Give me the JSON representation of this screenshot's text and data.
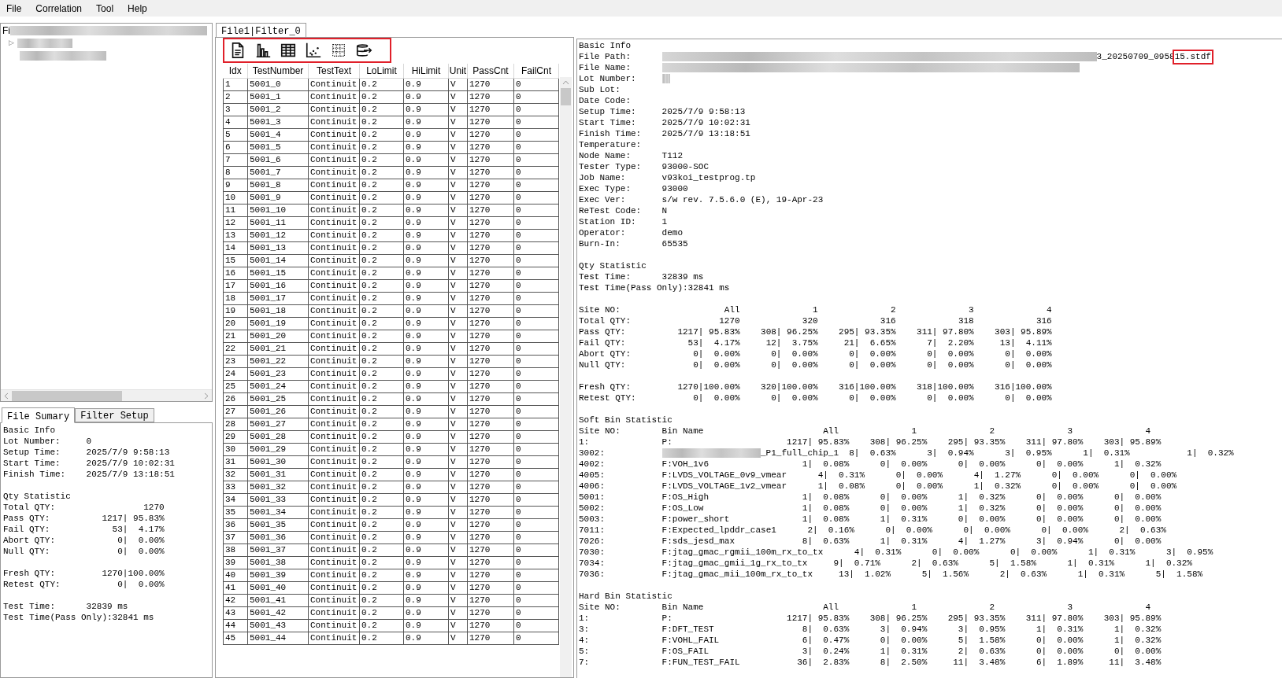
{
  "menu": [
    "File",
    "Correlation",
    "Tool",
    "Help"
  ],
  "file_tree": {
    "title": "Fi",
    "expander": "▷"
  },
  "left_tabs": [
    {
      "label": "File Sumary",
      "selected": true
    },
    {
      "label": "Filter Setup",
      "selected": false
    }
  ],
  "file_summary": {
    "basic_title": "Basic Info",
    "basic": [
      {
        "label": "Lot Number:",
        "value": "0"
      },
      {
        "label": "Setup Time:",
        "value": "2025/7/9 9:58:13"
      },
      {
        "label": "Start Time:",
        "value": "2025/7/9 10:02:31"
      },
      {
        "label": "Finish Time:",
        "value": "2025/7/9 13:18:51"
      }
    ],
    "qty_title": "Qty Statistic",
    "qty_lines": [
      "Total QTY:                 1270",
      "Pass QTY:          1217| 95.83%",
      "Fail QTY:            53|  4.17%",
      "Abort QTY:            0|  0.00%",
      "Null QTY:             0|  0.00%"
    ],
    "fresh_lines": [
      "Fresh QTY:         1270|100.00%",
      "Retest QTY:           0|  0.00%"
    ],
    "time": [
      {
        "label": "Test Time:",
        "value": "32839 ms"
      }
    ],
    "pass_only": "Test Time(Pass Only):32841 ms"
  },
  "doc_tabs": [
    {
      "label": "File1|Filter_0",
      "selected": true
    }
  ],
  "table": {
    "columns": [
      "Idx",
      "TestNumber",
      "TestText",
      "LoLimit",
      "HiLimit",
      "Unit",
      "PassCnt",
      "FailCnt"
    ],
    "rows": [
      [
        "1",
        "5001_0",
        "Continuit",
        "0.2",
        "0.9",
        "V",
        "1270",
        "0"
      ],
      [
        "2",
        "5001_1",
        "Continuit",
        "0.2",
        "0.9",
        "V",
        "1270",
        "0"
      ],
      [
        "3",
        "5001_2",
        "Continuit",
        "0.2",
        "0.9",
        "V",
        "1270",
        "0"
      ],
      [
        "4",
        "5001_3",
        "Continuit",
        "0.2",
        "0.9",
        "V",
        "1270",
        "0"
      ],
      [
        "5",
        "5001_4",
        "Continuit",
        "0.2",
        "0.9",
        "V",
        "1270",
        "0"
      ],
      [
        "6",
        "5001_5",
        "Continuit",
        "0.2",
        "0.9",
        "V",
        "1270",
        "0"
      ],
      [
        "7",
        "5001_6",
        "Continuit",
        "0.2",
        "0.9",
        "V",
        "1270",
        "0"
      ],
      [
        "8",
        "5001_7",
        "Continuit",
        "0.2",
        "0.9",
        "V",
        "1270",
        "0"
      ],
      [
        "9",
        "5001_8",
        "Continuit",
        "0.2",
        "0.9",
        "V",
        "1270",
        "0"
      ],
      [
        "10",
        "5001_9",
        "Continuit",
        "0.2",
        "0.9",
        "V",
        "1270",
        "0"
      ],
      [
        "11",
        "5001_10",
        "Continuit",
        "0.2",
        "0.9",
        "V",
        "1270",
        "0"
      ],
      [
        "12",
        "5001_11",
        "Continuit",
        "0.2",
        "0.9",
        "V",
        "1270",
        "0"
      ],
      [
        "13",
        "5001_12",
        "Continuit",
        "0.2",
        "0.9",
        "V",
        "1270",
        "0"
      ],
      [
        "14",
        "5001_13",
        "Continuit",
        "0.2",
        "0.9",
        "V",
        "1270",
        "0"
      ],
      [
        "15",
        "5001_14",
        "Continuit",
        "0.2",
        "0.9",
        "V",
        "1270",
        "0"
      ],
      [
        "16",
        "5001_15",
        "Continuit",
        "0.2",
        "0.9",
        "V",
        "1270",
        "0"
      ],
      [
        "17",
        "5001_16",
        "Continuit",
        "0.2",
        "0.9",
        "V",
        "1270",
        "0"
      ],
      [
        "18",
        "5001_17",
        "Continuit",
        "0.2",
        "0.9",
        "V",
        "1270",
        "0"
      ],
      [
        "19",
        "5001_18",
        "Continuit",
        "0.2",
        "0.9",
        "V",
        "1270",
        "0"
      ],
      [
        "20",
        "5001_19",
        "Continuit",
        "0.2",
        "0.9",
        "V",
        "1270",
        "0"
      ],
      [
        "21",
        "5001_20",
        "Continuit",
        "0.2",
        "0.9",
        "V",
        "1270",
        "0"
      ],
      [
        "22",
        "5001_21",
        "Continuit",
        "0.2",
        "0.9",
        "V",
        "1270",
        "0"
      ],
      [
        "23",
        "5001_22",
        "Continuit",
        "0.2",
        "0.9",
        "V",
        "1270",
        "0"
      ],
      [
        "24",
        "5001_23",
        "Continuit",
        "0.2",
        "0.9",
        "V",
        "1270",
        "0"
      ],
      [
        "25",
        "5001_24",
        "Continuit",
        "0.2",
        "0.9",
        "V",
        "1270",
        "0"
      ],
      [
        "26",
        "5001_25",
        "Continuit",
        "0.2",
        "0.9",
        "V",
        "1270",
        "0"
      ],
      [
        "27",
        "5001_26",
        "Continuit",
        "0.2",
        "0.9",
        "V",
        "1270",
        "0"
      ],
      [
        "28",
        "5001_27",
        "Continuit",
        "0.2",
        "0.9",
        "V",
        "1270",
        "0"
      ],
      [
        "29",
        "5001_28",
        "Continuit",
        "0.2",
        "0.9",
        "V",
        "1270",
        "0"
      ],
      [
        "30",
        "5001_29",
        "Continuit",
        "0.2",
        "0.9",
        "V",
        "1270",
        "0"
      ],
      [
        "31",
        "5001_30",
        "Continuit",
        "0.2",
        "0.9",
        "V",
        "1270",
        "0"
      ],
      [
        "32",
        "5001_31",
        "Continuit",
        "0.2",
        "0.9",
        "V",
        "1270",
        "0"
      ],
      [
        "33",
        "5001_32",
        "Continuit",
        "0.2",
        "0.9",
        "V",
        "1270",
        "0"
      ],
      [
        "34",
        "5001_33",
        "Continuit",
        "0.2",
        "0.9",
        "V",
        "1270",
        "0"
      ],
      [
        "35",
        "5001_34",
        "Continuit",
        "0.2",
        "0.9",
        "V",
        "1270",
        "0"
      ],
      [
        "36",
        "5001_35",
        "Continuit",
        "0.2",
        "0.9",
        "V",
        "1270",
        "0"
      ],
      [
        "37",
        "5001_36",
        "Continuit",
        "0.2",
        "0.9",
        "V",
        "1270",
        "0"
      ],
      [
        "38",
        "5001_37",
        "Continuit",
        "0.2",
        "0.9",
        "V",
        "1270",
        "0"
      ],
      [
        "39",
        "5001_38",
        "Continuit",
        "0.2",
        "0.9",
        "V",
        "1270",
        "0"
      ],
      [
        "40",
        "5001_39",
        "Continuit",
        "0.2",
        "0.9",
        "V",
        "1270",
        "0"
      ],
      [
        "41",
        "5001_40",
        "Continuit",
        "0.2",
        "0.9",
        "V",
        "1270",
        "0"
      ],
      [
        "42",
        "5001_41",
        "Continuit",
        "0.2",
        "0.9",
        "V",
        "1270",
        "0"
      ],
      [
        "43",
        "5001_42",
        "Continuit",
        "0.2",
        "0.9",
        "V",
        "1270",
        "0"
      ],
      [
        "44",
        "5001_43",
        "Continuit",
        "0.2",
        "0.9",
        "V",
        "1270",
        "0"
      ],
      [
        "45",
        "5001_44",
        "Continuit",
        "0.2",
        "0.9",
        "V",
        "1270",
        "0"
      ]
    ]
  },
  "report": {
    "basic_title": "Basic Info",
    "basic": [
      {
        "label": "File Path:",
        "value": "3_20250709_095815.stdf",
        "redacted": true,
        "annotated": true
      },
      {
        "label": "File Name:",
        "redacted": true,
        "annotated": false
      },
      {
        "label": "Lot Number:",
        "redacted": true,
        "annotated": false
      },
      {
        "label": "Sub Lot:",
        "redacted": false,
        "annotated": false
      },
      {
        "label": "Date Code:",
        "redacted": false,
        "annotated": false
      },
      {
        "label": "Setup Time:",
        "value": "2025/7/9 9:58:13",
        "redacted": false,
        "annotated": false
      },
      {
        "label": "Start Time:",
        "value": "2025/7/9 10:02:31",
        "redacted": false,
        "annotated": false
      },
      {
        "label": "Finish Time:",
        "value": "2025/7/9 13:18:51",
        "redacted": false,
        "annotated": false
      },
      {
        "label": "Temperature:",
        "redacted": false,
        "annotated": false
      },
      {
        "label": "Node Name:",
        "value": "T112",
        "redacted": false,
        "annotated": false
      },
      {
        "label": "Tester Type:",
        "value": "93000-SOC",
        "redacted": false,
        "annotated": false
      },
      {
        "label": "Job Name:",
        "value": "v93koi_testprog.tp",
        "redacted": false,
        "annotated": false
      },
      {
        "label": "Exec Type:",
        "value": "93000",
        "redacted": false,
        "annotated": false
      },
      {
        "label": "Exec Ver:",
        "value": "s/w rev. 7.5.6.0 (E), 19-Apr-23",
        "redacted": false,
        "annotated": false
      },
      {
        "label": "ReTest Code:",
        "value": "N",
        "redacted": false,
        "annotated": false
      },
      {
        "label": "Station ID:",
        "value": "1",
        "redacted": false,
        "annotated": false
      },
      {
        "label": "Operator:",
        "value": "demo",
        "redacted": false,
        "annotated": false
      },
      {
        "label": "Burn-In:",
        "value": "65535",
        "redacted": false,
        "annotated": false
      }
    ],
    "qty_title": "Qty Statistic",
    "time": [
      {
        "label": "Test Time:",
        "value": "32839 ms"
      }
    ],
    "pass_only": "Test Time(Pass Only):32841 ms",
    "site_lines": [
      "Site NO:                    All              1              2              3              4",
      "Total QTY:                 1270            320            316            318            316",
      "Pass QTY:          1217| 95.83%    308| 96.25%    295| 93.35%    311| 97.80%    303| 95.89%",
      "Fail QTY:            53|  4.17%     12|  3.75%     21|  6.65%      7|  2.20%     13|  4.11%",
      "Abort QTY:            0|  0.00%      0|  0.00%      0|  0.00%      0|  0.00%      0|  0.00%",
      "Null QTY:             0|  0.00%      0|  0.00%      0|  0.00%      0|  0.00%      0|  0.00%"
    ],
    "fresh_lines": [
      "Fresh QTY:         1270|100.00%    320|100.00%    316|100.00%    318|100.00%    316|100.00%",
      "Retest QTY:           0|  0.00%      0|  0.00%      0|  0.00%      0|  0.00%      0|  0.00%"
    ],
    "bin_sections": [
      {
        "title": "Soft Bin Statistic",
        "rows": [
          {
            "code": "Site NO:",
            "redacted": false,
            "rest": "Bin Name                       All              1              2              3              4"
          },
          {
            "code": "1:",
            "redacted": false,
            "rest": "P:                      1217| 95.83%    308| 96.25%    295| 93.35%    311| 97.80%    303| 95.89%"
          },
          {
            "code": "3002:",
            "redacted": true,
            "rest": "_P1_full_chip_1  8|  0.63%      3|  0.94%      3|  0.95%      1|  0.31%           1|  0.32%"
          },
          {
            "code": "4002:",
            "redacted": false,
            "rest": "F:VOH_1v6                  1|  0.08%      0|  0.00%      0|  0.00%      0|  0.00%      1|  0.32%"
          },
          {
            "code": "4005:",
            "redacted": false,
            "rest": "F:LVDS_VOLTAGE_0v9_vmear      4|  0.31%      0|  0.00%      4|  1.27%      0|  0.00%      0|  0.00%"
          },
          {
            "code": "4006:",
            "redacted": false,
            "rest": "F:LVDS_VOLTAGE_1v2_vmear      1|  0.08%      0|  0.00%      1|  0.32%      0|  0.00%      0|  0.00%"
          },
          {
            "code": "5001:",
            "redacted": false,
            "rest": "F:OS_High                  1|  0.08%      0|  0.00%      1|  0.32%      0|  0.00%      0|  0.00%"
          },
          {
            "code": "5002:",
            "redacted": false,
            "rest": "F:OS_Low                   1|  0.08%      0|  0.00%      1|  0.32%      0|  0.00%      0|  0.00%"
          },
          {
            "code": "5003:",
            "redacted": false,
            "rest": "F:power_short              1|  0.08%      1|  0.31%      0|  0.00%      0|  0.00%      0|  0.00%"
          },
          {
            "code": "7011:",
            "redacted": false,
            "rest": "F:Expected_lpddr_case1      2|  0.16%      0|  0.00%      0|  0.00%      0|  0.00%      2|  0.63%"
          },
          {
            "code": "7026:",
            "redacted": false,
            "rest": "F:sds_jesd_max             8|  0.63%      1|  0.31%      4|  1.27%      3|  0.94%      0|  0.00%"
          },
          {
            "code": "7030:",
            "redacted": false,
            "rest": "F:jtag_gmac_rgmii_100m_rx_to_tx      4|  0.31%      0|  0.00%      0|  0.00%      1|  0.31%      3|  0.95%"
          },
          {
            "code": "7034:",
            "redacted": false,
            "rest": "F:jtag_gmac_gmii_1g_rx_to_tx     9|  0.71%      2|  0.63%      5|  1.58%      1|  0.31%      1|  0.32%"
          },
          {
            "code": "7036:",
            "redacted": false,
            "rest": "F:jtag_gmac_mii_100m_rx_to_tx     13|  1.02%      5|  1.56%      2|  0.63%      1|  0.31%      5|  1.58%"
          }
        ]
      },
      {
        "title": "Hard Bin Statistic",
        "rows": [
          {
            "code": "Site NO:",
            "redacted": false,
            "rest": "Bin Name                       All              1              2              3              4"
          },
          {
            "code": "1:",
            "redacted": false,
            "rest": "P:                      1217| 95.83%    308| 96.25%    295| 93.35%    311| 97.80%    303| 95.89%"
          },
          {
            "code": "3:",
            "redacted": false,
            "rest": "F:DFT_TEST                 8|  0.63%      3|  0.94%      3|  0.95%      1|  0.31%      1|  0.32%"
          },
          {
            "code": "4:",
            "redacted": false,
            "rest": "F:VOHL_FAIL                6|  0.47%      0|  0.00%      5|  1.58%      0|  0.00%      1|  0.32%"
          },
          {
            "code": "5:",
            "redacted": false,
            "rest": "F:OS_FAIL                  3|  0.24%      1|  0.31%      2|  0.63%      0|  0.00%      0|  0.00%"
          },
          {
            "code": "7:",
            "redacted": false,
            "rest": "F:FUN_TEST_FAIL           36|  2.83%      8|  2.50%     11|  3.48%      6|  1.89%     11|  3.48%"
          }
        ]
      }
    ]
  }
}
